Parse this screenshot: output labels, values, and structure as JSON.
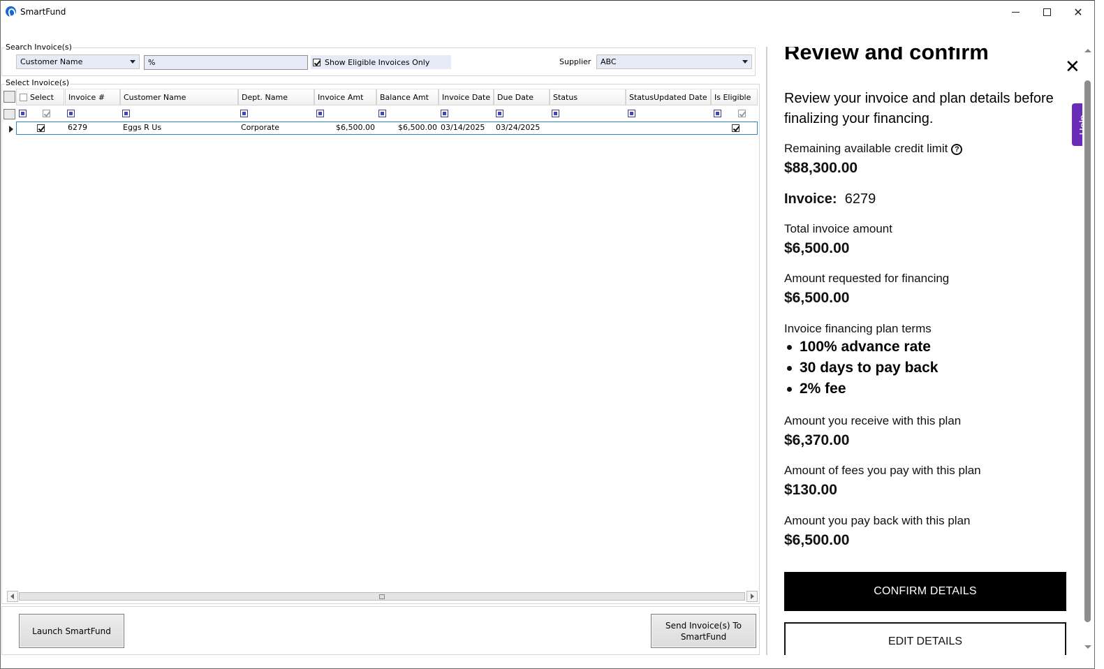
{
  "window": {
    "title": "SmartFund"
  },
  "search": {
    "group_label": "Search Invoice(s)",
    "field_select": "Customer Name",
    "search_value": "%",
    "eligible_only_label": "Show Eligible Invoices Only",
    "eligible_only_checked": true,
    "supplier_label": "Supplier",
    "supplier_value": "ABC"
  },
  "grid": {
    "group_label": "Select Invoice(s)",
    "columns": [
      "Select",
      "Invoice #",
      "Customer Name",
      "Dept. Name",
      "Invoice Amt",
      "Balance Amt",
      "Invoice Date",
      "Due Date",
      "Status",
      "StatusUpdated Date",
      "Is Eligible"
    ],
    "rows": [
      {
        "selected": true,
        "invoice": "6279",
        "customer": "Eggs R Us",
        "dept": "Corporate",
        "invoice_amt": "$6,500.00",
        "balance_amt": "$6,500.00",
        "invoice_date": "03/14/2025",
        "due_date": "03/24/2025",
        "status": "",
        "status_updated": "",
        "is_eligible": true
      }
    ]
  },
  "buttons": {
    "launch": "Launch SmartFund",
    "send_line1": "Send Invoice(s) To",
    "send_line2": "SmartFund"
  },
  "review": {
    "title": "Review and confirm",
    "description": "Review your invoice and plan details before finalizing your financing.",
    "credit_label": "Remaining available credit limit",
    "credit_value": "$88,300.00",
    "invoice_label": "Invoice:",
    "invoice_value": "6279",
    "total_label": "Total invoice amount",
    "total_value": "$6,500.00",
    "requested_label": "Amount requested for financing",
    "requested_value": "$6,500.00",
    "terms_label": "Invoice financing plan terms",
    "terms": [
      "100% advance rate",
      "30 days to pay back",
      "2% fee"
    ],
    "receive_label": "Amount you receive with this plan",
    "receive_value": "$6,370.00",
    "fees_label": "Amount of fees you pay with this plan",
    "fees_value": "$130.00",
    "payback_label": "Amount you pay back with this plan",
    "payback_value": "$6,500.00",
    "confirm_button": "CONFIRM DETAILS",
    "edit_button": "EDIT DETAILS",
    "help_tab": "Help"
  }
}
